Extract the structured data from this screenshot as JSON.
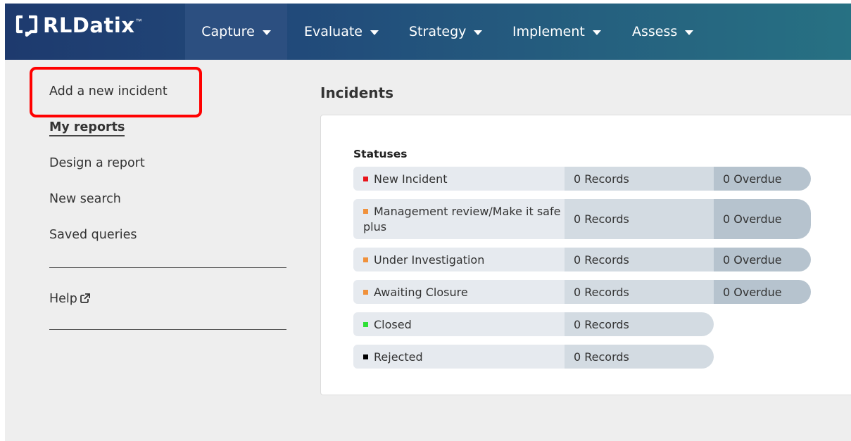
{
  "brand": {
    "name": "RLDatix",
    "tm": "™"
  },
  "nav": [
    {
      "label": "Capture",
      "active": true
    },
    {
      "label": "Evaluate",
      "active": false
    },
    {
      "label": "Strategy",
      "active": false
    },
    {
      "label": "Implement",
      "active": false
    },
    {
      "label": "Assess",
      "active": false
    }
  ],
  "sidebar": {
    "items": [
      {
        "label": "Add a new incident"
      },
      {
        "label": "My reports",
        "active": true
      },
      {
        "label": "Design a report"
      },
      {
        "label": "New search"
      },
      {
        "label": "Saved queries"
      }
    ],
    "help_label": "Help"
  },
  "main": {
    "title": "Incidents",
    "statuses_heading": "Statuses",
    "statuses": [
      {
        "name": "New Incident",
        "color": "#e8141b",
        "records": "0 Records",
        "overdue": "0 Overdue"
      },
      {
        "name": "Management review/Make it safe plus",
        "name_line1": "Management review/Make it safe",
        "name_line2": "plus",
        "color": "#f0913b",
        "records": "0 Records",
        "overdue": "0 Overdue"
      },
      {
        "name": "Under Investigation",
        "color": "#f0913b",
        "records": "0 Records",
        "overdue": "0 Overdue"
      },
      {
        "name": "Awaiting Closure",
        "color": "#f0913b",
        "records": "0 Records",
        "overdue": "0 Overdue"
      },
      {
        "name": "Closed",
        "color": "#2ee036",
        "records": "0 Records"
      },
      {
        "name": "Rejected",
        "color": "#000000",
        "records": "0 Records"
      }
    ]
  },
  "annotation": {
    "highlight_color": "#ff0000"
  }
}
